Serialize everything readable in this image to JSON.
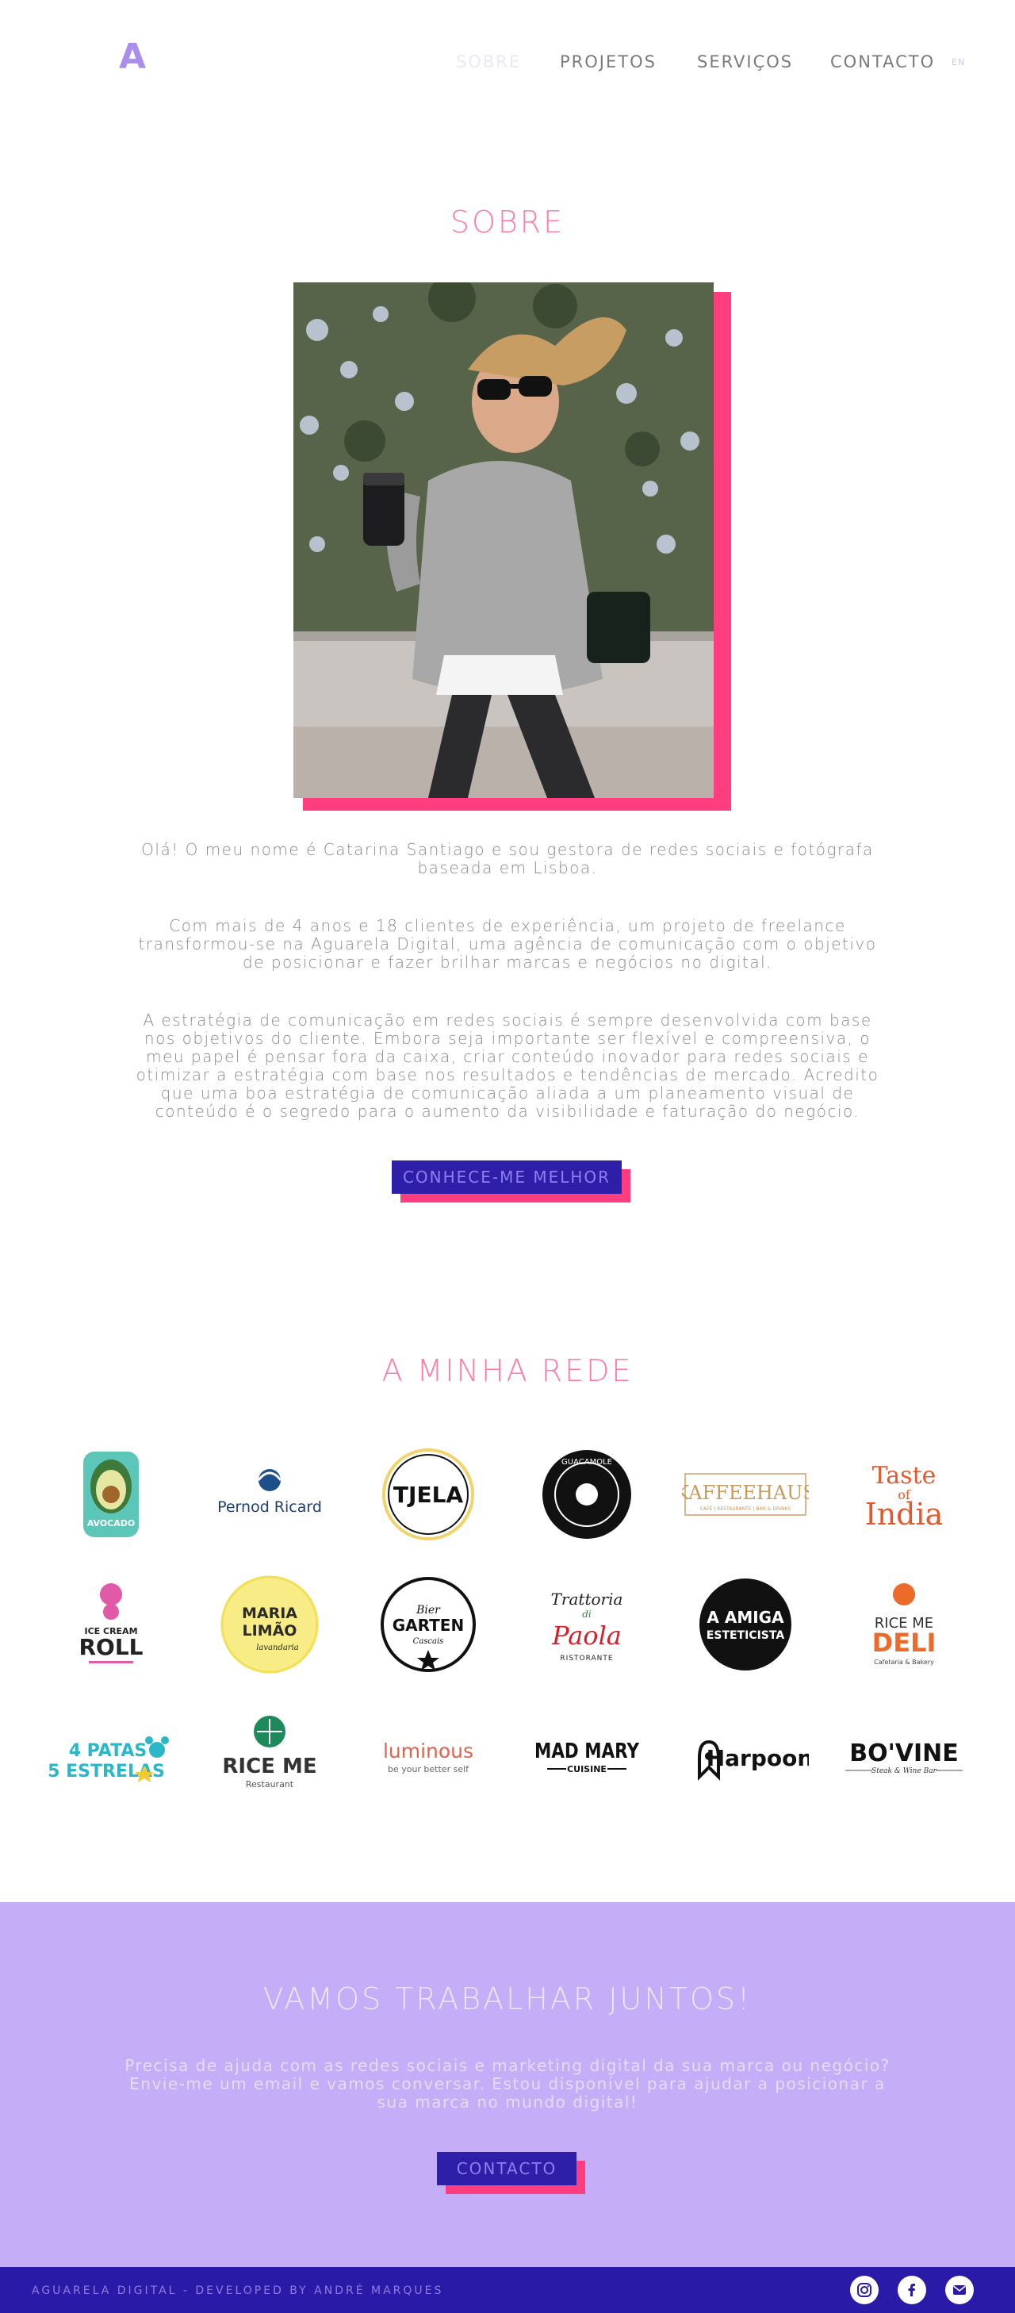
{
  "header": {
    "logo": "A",
    "nav": [
      "SOBRE",
      "PROJETOS",
      "SERVIÇOS",
      "CONTACTO"
    ],
    "lang": "EN"
  },
  "about": {
    "title": "SOBRE",
    "photo_alt": "Catarina Santiago",
    "paragraphs": [
      "Olá! O meu nome é Catarina Santiago e sou gestora de redes sociais e fotógrafa baseada em Lisboa.",
      "Com mais de 4 anos e 18 clientes de experiência, um projeto de freelance transformou-se na Aguarela Digital, uma agência de comunicação com o objetivo de posicionar e fazer brilhar marcas e negócios no digital.",
      "A estratégia de comunicação em redes sociais é sempre desenvolvida com base nos objetivos do cliente. Embora seja importante ser flexível e compreensiva, o meu papel é pensar fora da caixa, criar conteúdo inovador para redes sociais e otimizar a estratégia com base nos resultados e tendências de mercado. Acredito que uma boa estratégia de comunicação aliada a um planeamento visual de conteúdo é o segredo para o aumento da visibilidade e faturação do negócio."
    ],
    "button": "CONHECE-ME MELHOR"
  },
  "network": {
    "title": "A MINHA REDE",
    "logos": [
      {
        "name": "Avocado",
        "lines": [
          "AVOCADO"
        ]
      },
      {
        "name": "Pernod Ricard",
        "lines": [
          "Pernod Ricard"
        ]
      },
      {
        "name": "Tjela",
        "lines": [
          "TJELA"
        ]
      },
      {
        "name": "Guacamole",
        "lines": [
          "GUACAMOLE"
        ]
      },
      {
        "name": "Kaffeehaus",
        "lines": [
          "KAFFEEHAUS",
          "CAFÉ | RESTAURANTE | BAR & DRINKS"
        ]
      },
      {
        "name": "Taste of India",
        "lines": [
          "Taste",
          "of",
          "India"
        ]
      },
      {
        "name": "Ice Cream Roll",
        "lines": [
          "ICE CREAM",
          "ROLL"
        ]
      },
      {
        "name": "Maria Limão",
        "lines": [
          "MARIA",
          "LIMÃO",
          "lavandaria"
        ]
      },
      {
        "name": "Bier Garten",
        "lines": [
          "Bier",
          "GARTEN",
          "Cascais"
        ]
      },
      {
        "name": "Trattoria di Paola",
        "lines": [
          "Trattoria",
          "di",
          "Paola",
          "RISTORANTE"
        ]
      },
      {
        "name": "A Amiga Esteticista",
        "lines": [
          "A AMIGA",
          "ESTETICISTA"
        ]
      },
      {
        "name": "Rice Me Deli",
        "lines": [
          "RICE ME",
          "DELI",
          "Cafetaria & Bakery"
        ]
      },
      {
        "name": "4 Patas 5 Estrelas",
        "lines": [
          "4 PATAS",
          "5 ESTRELAS"
        ]
      },
      {
        "name": "Rice Me",
        "lines": [
          "RICE ME",
          "Restaurant"
        ]
      },
      {
        "name": "Luminous",
        "lines": [
          "luminous",
          "be your better self"
        ]
      },
      {
        "name": "Mad Mary",
        "lines": [
          "MAD MARY",
          "CUISINE"
        ]
      },
      {
        "name": "Harpoon",
        "lines": [
          "Harpoon"
        ]
      },
      {
        "name": "Bo'vine",
        "lines": [
          "BO'VINE",
          "Steak & Wine Bar"
        ]
      }
    ]
  },
  "cta": {
    "title": "VAMOS TRABALHAR JUNTOS!",
    "text": "Precisa de ajuda com as redes sociais e marketing digital da sua marca ou negócio? Envie-me um email e vamos conversar. Estou disponível para ajudar a posicionar a sua marca no mundo digital!",
    "button": "CONTACTO"
  },
  "footer": {
    "text": "AGUARELA DIGITAL - DEVELOPED BY ANDRÉ MARQUES",
    "social": [
      "instagram-icon",
      "facebook-icon",
      "email-icon"
    ]
  },
  "colors": {
    "accent_pink": "#ff3d7f",
    "title_pink": "#ff7aa6",
    "brand_blue": "#2d1fa8",
    "lavender": "#c5adf8"
  }
}
